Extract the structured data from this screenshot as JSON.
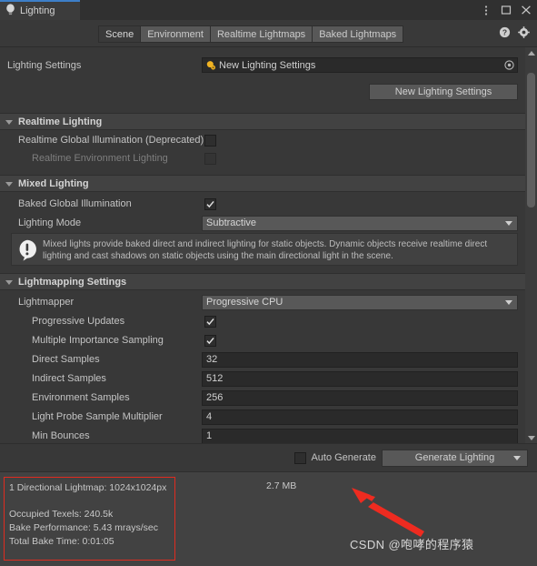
{
  "window": {
    "tab_title": "Lighting",
    "tab_icon": "lightbulb-icon",
    "menu_icon": "kebab-menu-icon",
    "maximize_icon": "maximize-icon",
    "close_icon": "close-icon"
  },
  "tabbar": {
    "tabs": [
      {
        "label": "Scene",
        "active": true
      },
      {
        "label": "Environment",
        "active": false
      },
      {
        "label": "Realtime Lightmaps",
        "active": false
      },
      {
        "label": "Baked Lightmaps",
        "active": false
      }
    ],
    "help_icon": "help-icon",
    "settings_icon": "gear-icon"
  },
  "lighting_settings": {
    "label": "Lighting Settings",
    "asset_name": "New Lighting Settings",
    "asset_icon": "lighting-settings-asset-icon",
    "picker_icon": "object-picker-icon",
    "new_button": "New Lighting Settings"
  },
  "realtime_lighting": {
    "header": "Realtime Lighting",
    "rows": [
      {
        "label": "Realtime Global Illumination (Deprecated)",
        "checked": false,
        "dim": false
      },
      {
        "label": "Realtime Environment Lighting",
        "checked": false,
        "dim": true
      }
    ]
  },
  "mixed_lighting": {
    "header": "Mixed Lighting",
    "baked_gi_label": "Baked Global Illumination",
    "baked_gi_checked": true,
    "lighting_mode_label": "Lighting Mode",
    "lighting_mode_value": "Subtractive",
    "info_icon": "warning-info-icon",
    "info_text": "Mixed lights provide baked direct and indirect lighting for static objects. Dynamic objects receive realtime direct lighting and cast shadows on static objects using the main directional light in the scene."
  },
  "lightmapping_settings": {
    "header": "Lightmapping Settings",
    "lightmapper_label": "Lightmapper",
    "lightmapper_value": "Progressive CPU",
    "toggles": [
      {
        "label": "Progressive Updates",
        "checked": true
      },
      {
        "label": "Multiple Importance Sampling",
        "checked": true
      }
    ],
    "fields": [
      {
        "label": "Direct Samples",
        "value": "32"
      },
      {
        "label": "Indirect Samples",
        "value": "512"
      },
      {
        "label": "Environment Samples",
        "value": "256"
      },
      {
        "label": "Light Probe Sample Multiplier",
        "value": "4"
      },
      {
        "label": "Min Bounces",
        "value": "1"
      }
    ]
  },
  "generate_bar": {
    "auto_generate_label": "Auto Generate",
    "auto_generate_checked": false,
    "generate_button": "Generate Lighting"
  },
  "status": {
    "lightmap_line": "1 Directional Lightmap: 1024x1024px",
    "occupied_texels": "Occupied Texels: 240.5k",
    "bake_performance": "Bake Performance: 5.43 mrays/sec",
    "total_bake_time": "Total Bake Time: 0:01:05",
    "memory": "2.7 MB",
    "highlight_color": "#e02b20"
  },
  "annotation": {
    "arrow_icon": "red-arrow-annotation",
    "watermark": "CSDN @咆哮的程序猿"
  }
}
